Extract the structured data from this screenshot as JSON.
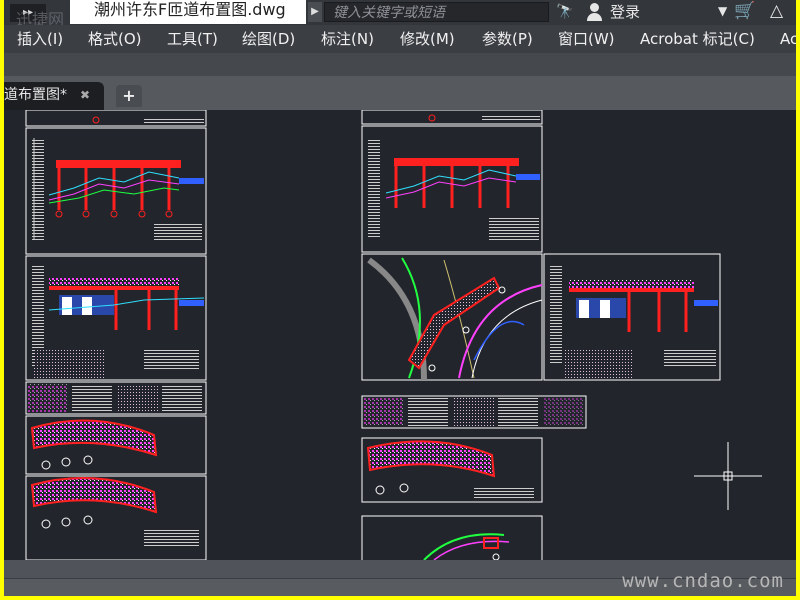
{
  "titlebar": {
    "quick_access": "▸▸",
    "watermark_left": "迅捷网",
    "file_tab_title": "潮州许东F匝道布置图.dwg",
    "search_placeholder": "键入关键字或短语",
    "login_label": "登录"
  },
  "menu": {
    "items": [
      {
        "label": "插入(I)"
      },
      {
        "label": "格式(O)"
      },
      {
        "label": "工具(T)"
      },
      {
        "label": "绘图(D)"
      },
      {
        "label": "标注(N)"
      },
      {
        "label": "修改(M)"
      },
      {
        "label": "参数(P)"
      },
      {
        "label": "窗口(W)"
      },
      {
        "label": "Acrobat 标记(C)"
      },
      {
        "label": "Ac"
      }
    ]
  },
  "tabs": {
    "active_label": "道布置图*",
    "close_glyph": "✖",
    "add_glyph": "+"
  },
  "footer": {
    "watermark_right": "www.cndao.com"
  },
  "colors": {
    "canvas_bg": "#22252b",
    "cad_red": "#ff2020",
    "cad_magenta": "#ff40ff",
    "cad_green": "#20ff40",
    "cad_blue": "#3060ff",
    "cad_cyan": "#30e0ff",
    "frame_yellow": "#ffff00"
  }
}
